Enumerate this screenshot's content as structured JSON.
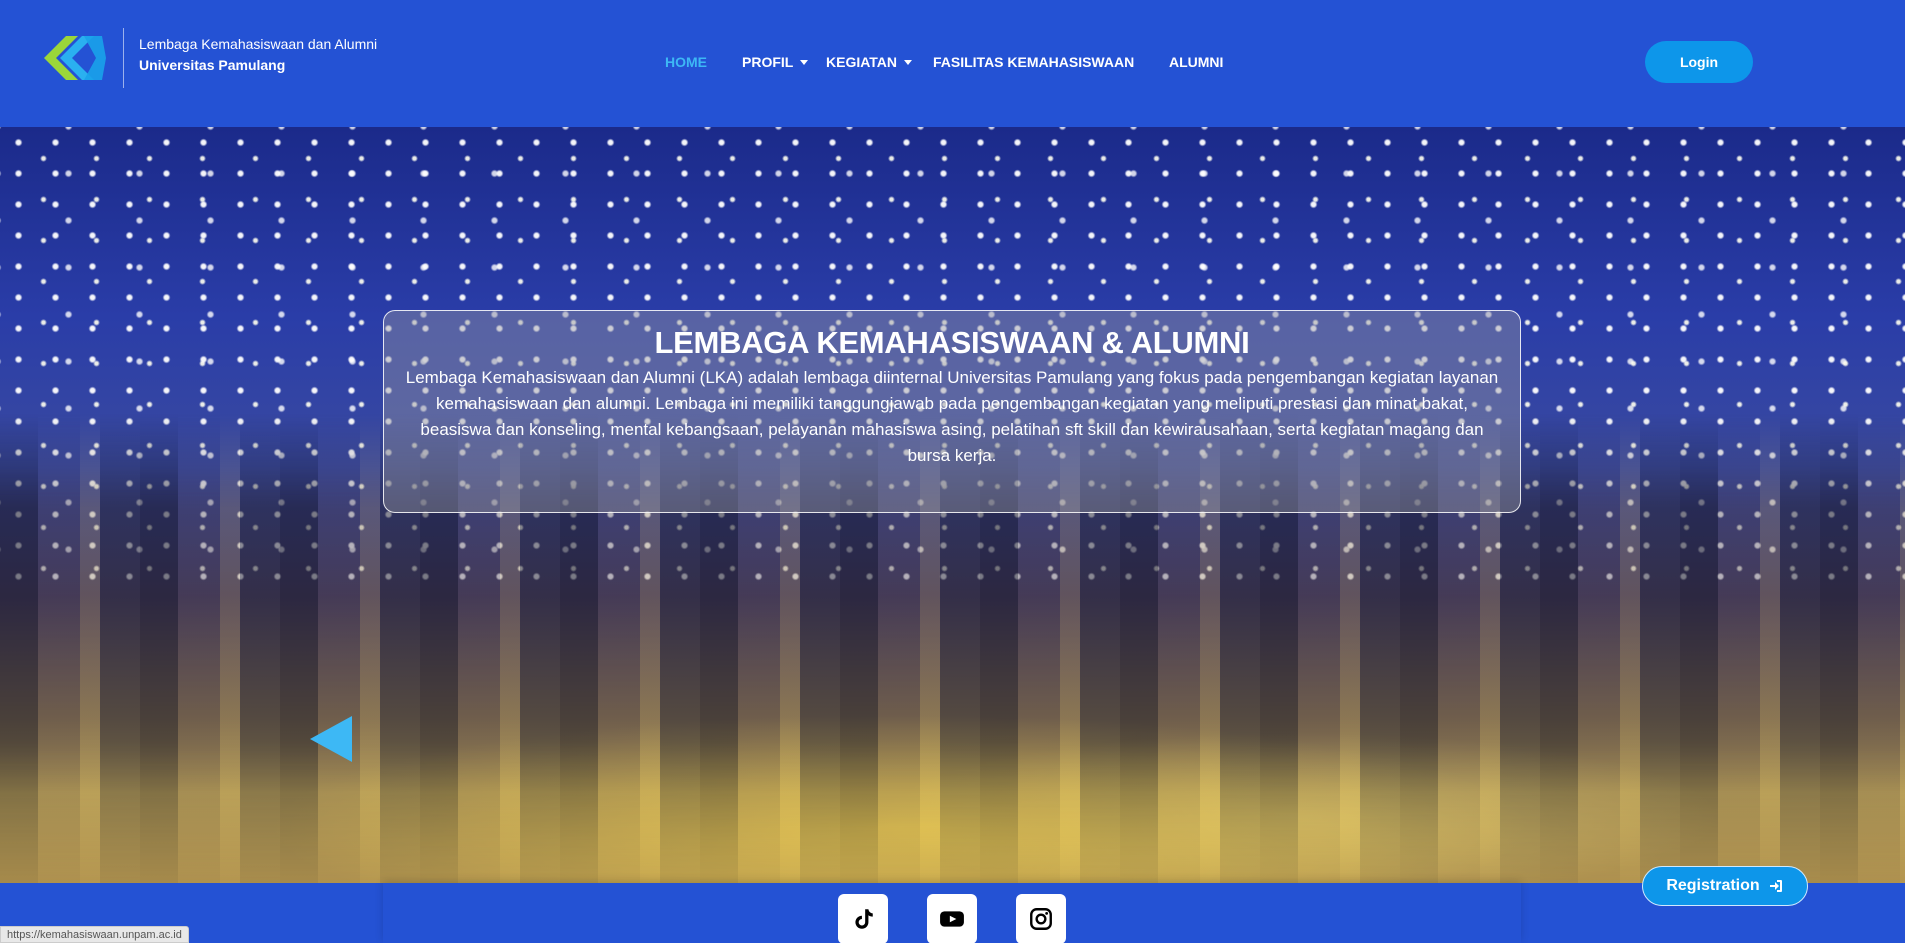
{
  "brand": {
    "line1": "Lembaga Kemahasiswaan dan Alumni",
    "line2": "Universitas Pamulang"
  },
  "nav": {
    "items": [
      {
        "label": "HOME",
        "active": true,
        "dropdown": false
      },
      {
        "label": "PROFIL",
        "active": false,
        "dropdown": true
      },
      {
        "label": "KEGIATAN",
        "active": false,
        "dropdown": true
      },
      {
        "label": "FASILITAS KEMAHASISWAAN",
        "active": false,
        "dropdown": false
      },
      {
        "label": "ALUMNI",
        "active": false,
        "dropdown": false
      }
    ],
    "login_label": "Login"
  },
  "hero": {
    "title": "LEMBAGA KEMAHASISWAAN & ALUMNI",
    "description": "Lembaga Kemahasiswaan dan Alumni (LKA) adalah lembaga diinternal Universitas Pamulang yang fokus pada pengembangan kegiatan layanan kemahasiswaan dan alumni. Lembaga ini memiliki tanggungjawab pada pengembangan kegiatan yang meliputi prestasi dan minat bakat, beasiswa dan konseling, mental kebangsaan, pelayanan mahasiswa asing, pelatihan sft skill dan kewirausahaan, serta kegiatan magang dan bursa kerja."
  },
  "social": {
    "icons": [
      "tiktok-icon",
      "youtube-icon",
      "instagram-icon"
    ]
  },
  "registration_label": "Registration",
  "status_url": "https://kemahasiswaan.unpam.ac.id",
  "colors": {
    "primary": "#2452d4",
    "accent": "#0d96ea",
    "active_nav": "#3db8f5",
    "logo_green": "#9bd63a",
    "logo_blue": "#2ab0f0"
  }
}
